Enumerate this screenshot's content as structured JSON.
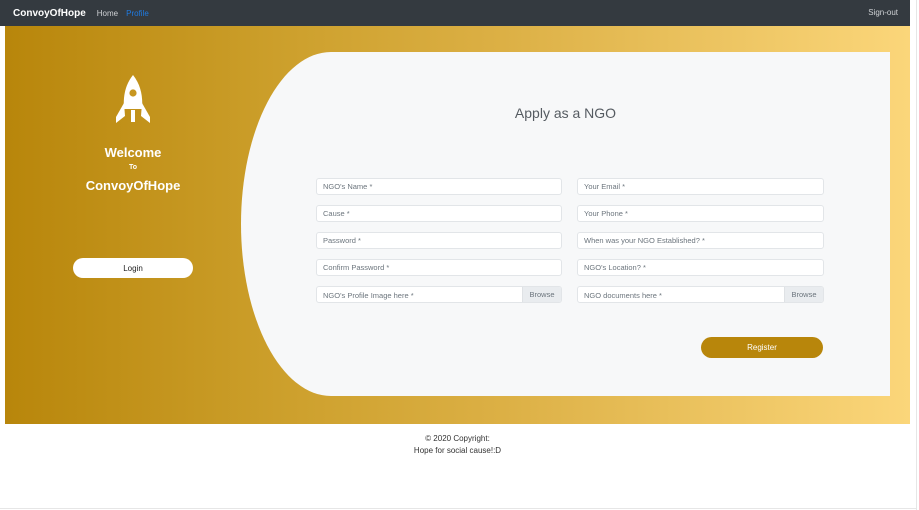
{
  "navbar": {
    "brand": "ConvoyOfHope",
    "links": [
      {
        "label": "Home"
      },
      {
        "label": "Profile"
      }
    ],
    "signout": "Sign-out"
  },
  "left_panel": {
    "icon": "rocket-icon",
    "welcome": "Welcome",
    "to": "To",
    "brand": "ConvoyOfHope",
    "login_label": "Login"
  },
  "form": {
    "title": "Apply as a NGO",
    "ngo_name_placeholder": "NGO's Name *",
    "email_placeholder": "Your Email *",
    "cause_placeholder": "Cause *",
    "phone_placeholder": "Your Phone *",
    "password_placeholder": "Password *",
    "established_placeholder": "When was your NGO Established? *",
    "confirm_password_placeholder": "Confirm Password *",
    "location_placeholder": "NGO's Location? *",
    "profile_image_label": "NGO's Profile Image here *",
    "documents_label": "NGO documents here *",
    "browse_label": "Browse",
    "register_label": "Register"
  },
  "footer": {
    "line1": "© 2020 Copyright:",
    "line2": "Hope for social cause!:D"
  },
  "colors": {
    "navbar_bg": "#343a40",
    "accent": "#b8860b",
    "gradient_end": "#fbd67a",
    "active_link": "#1f7ae0",
    "card_bg": "#f7f8f9"
  }
}
